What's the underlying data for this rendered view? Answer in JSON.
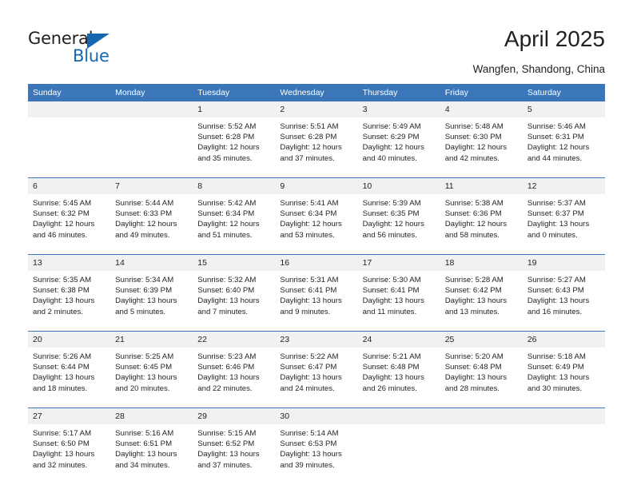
{
  "brand": {
    "name_part1": "General",
    "name_part2": "Blue",
    "triangle_color": "#1567b2"
  },
  "header": {
    "title": "April 2025",
    "subtitle": "Wangfen, Shandong, China",
    "accent_color": "#3a76b8",
    "daynum_band_color": "#f1f1f1"
  },
  "weekday_headers": [
    "Sunday",
    "Monday",
    "Tuesday",
    "Wednesday",
    "Thursday",
    "Friday",
    "Saturday"
  ],
  "labels": {
    "sunrise_prefix": "Sunrise:",
    "sunset_prefix": "Sunset:",
    "daylight_prefix": "Daylight:"
  },
  "weeks": [
    [
      {
        "day": "",
        "sunrise": "",
        "sunset": "",
        "daylight": "",
        "blank": true
      },
      {
        "day": "",
        "sunrise": "",
        "sunset": "",
        "daylight": "",
        "blank": true
      },
      {
        "day": "1",
        "sunrise": "Sunrise: 5:52 AM",
        "sunset": "Sunset: 6:28 PM",
        "daylight": "Daylight: 12 hours and 35 minutes."
      },
      {
        "day": "2",
        "sunrise": "Sunrise: 5:51 AM",
        "sunset": "Sunset: 6:28 PM",
        "daylight": "Daylight: 12 hours and 37 minutes."
      },
      {
        "day": "3",
        "sunrise": "Sunrise: 5:49 AM",
        "sunset": "Sunset: 6:29 PM",
        "daylight": "Daylight: 12 hours and 40 minutes."
      },
      {
        "day": "4",
        "sunrise": "Sunrise: 5:48 AM",
        "sunset": "Sunset: 6:30 PM",
        "daylight": "Daylight: 12 hours and 42 minutes."
      },
      {
        "day": "5",
        "sunrise": "Sunrise: 5:46 AM",
        "sunset": "Sunset: 6:31 PM",
        "daylight": "Daylight: 12 hours and 44 minutes."
      }
    ],
    [
      {
        "day": "6",
        "sunrise": "Sunrise: 5:45 AM",
        "sunset": "Sunset: 6:32 PM",
        "daylight": "Daylight: 12 hours and 46 minutes."
      },
      {
        "day": "7",
        "sunrise": "Sunrise: 5:44 AM",
        "sunset": "Sunset: 6:33 PM",
        "daylight": "Daylight: 12 hours and 49 minutes."
      },
      {
        "day": "8",
        "sunrise": "Sunrise: 5:42 AM",
        "sunset": "Sunset: 6:34 PM",
        "daylight": "Daylight: 12 hours and 51 minutes."
      },
      {
        "day": "9",
        "sunrise": "Sunrise: 5:41 AM",
        "sunset": "Sunset: 6:34 PM",
        "daylight": "Daylight: 12 hours and 53 minutes."
      },
      {
        "day": "10",
        "sunrise": "Sunrise: 5:39 AM",
        "sunset": "Sunset: 6:35 PM",
        "daylight": "Daylight: 12 hours and 56 minutes."
      },
      {
        "day": "11",
        "sunrise": "Sunrise: 5:38 AM",
        "sunset": "Sunset: 6:36 PM",
        "daylight": "Daylight: 12 hours and 58 minutes."
      },
      {
        "day": "12",
        "sunrise": "Sunrise: 5:37 AM",
        "sunset": "Sunset: 6:37 PM",
        "daylight": "Daylight: 13 hours and 0 minutes."
      }
    ],
    [
      {
        "day": "13",
        "sunrise": "Sunrise: 5:35 AM",
        "sunset": "Sunset: 6:38 PM",
        "daylight": "Daylight: 13 hours and 2 minutes."
      },
      {
        "day": "14",
        "sunrise": "Sunrise: 5:34 AM",
        "sunset": "Sunset: 6:39 PM",
        "daylight": "Daylight: 13 hours and 5 minutes."
      },
      {
        "day": "15",
        "sunrise": "Sunrise: 5:32 AM",
        "sunset": "Sunset: 6:40 PM",
        "daylight": "Daylight: 13 hours and 7 minutes."
      },
      {
        "day": "16",
        "sunrise": "Sunrise: 5:31 AM",
        "sunset": "Sunset: 6:41 PM",
        "daylight": "Daylight: 13 hours and 9 minutes."
      },
      {
        "day": "17",
        "sunrise": "Sunrise: 5:30 AM",
        "sunset": "Sunset: 6:41 PM",
        "daylight": "Daylight: 13 hours and 11 minutes."
      },
      {
        "day": "18",
        "sunrise": "Sunrise: 5:28 AM",
        "sunset": "Sunset: 6:42 PM",
        "daylight": "Daylight: 13 hours and 13 minutes."
      },
      {
        "day": "19",
        "sunrise": "Sunrise: 5:27 AM",
        "sunset": "Sunset: 6:43 PM",
        "daylight": "Daylight: 13 hours and 16 minutes."
      }
    ],
    [
      {
        "day": "20",
        "sunrise": "Sunrise: 5:26 AM",
        "sunset": "Sunset: 6:44 PM",
        "daylight": "Daylight: 13 hours and 18 minutes."
      },
      {
        "day": "21",
        "sunrise": "Sunrise: 5:25 AM",
        "sunset": "Sunset: 6:45 PM",
        "daylight": "Daylight: 13 hours and 20 minutes."
      },
      {
        "day": "22",
        "sunrise": "Sunrise: 5:23 AM",
        "sunset": "Sunset: 6:46 PM",
        "daylight": "Daylight: 13 hours and 22 minutes."
      },
      {
        "day": "23",
        "sunrise": "Sunrise: 5:22 AM",
        "sunset": "Sunset: 6:47 PM",
        "daylight": "Daylight: 13 hours and 24 minutes."
      },
      {
        "day": "24",
        "sunrise": "Sunrise: 5:21 AM",
        "sunset": "Sunset: 6:48 PM",
        "daylight": "Daylight: 13 hours and 26 minutes."
      },
      {
        "day": "25",
        "sunrise": "Sunrise: 5:20 AM",
        "sunset": "Sunset: 6:48 PM",
        "daylight": "Daylight: 13 hours and 28 minutes."
      },
      {
        "day": "26",
        "sunrise": "Sunrise: 5:18 AM",
        "sunset": "Sunset: 6:49 PM",
        "daylight": "Daylight: 13 hours and 30 minutes."
      }
    ],
    [
      {
        "day": "27",
        "sunrise": "Sunrise: 5:17 AM",
        "sunset": "Sunset: 6:50 PM",
        "daylight": "Daylight: 13 hours and 32 minutes."
      },
      {
        "day": "28",
        "sunrise": "Sunrise: 5:16 AM",
        "sunset": "Sunset: 6:51 PM",
        "daylight": "Daylight: 13 hours and 34 minutes."
      },
      {
        "day": "29",
        "sunrise": "Sunrise: 5:15 AM",
        "sunset": "Sunset: 6:52 PM",
        "daylight": "Daylight: 13 hours and 37 minutes."
      },
      {
        "day": "30",
        "sunrise": "Sunrise: 5:14 AM",
        "sunset": "Sunset: 6:53 PM",
        "daylight": "Daylight: 13 hours and 39 minutes."
      },
      {
        "day": "",
        "sunrise": "",
        "sunset": "",
        "daylight": "",
        "blank": true
      },
      {
        "day": "",
        "sunrise": "",
        "sunset": "",
        "daylight": "",
        "blank": true
      },
      {
        "day": "",
        "sunrise": "",
        "sunset": "",
        "daylight": "",
        "blank": true
      }
    ]
  ]
}
